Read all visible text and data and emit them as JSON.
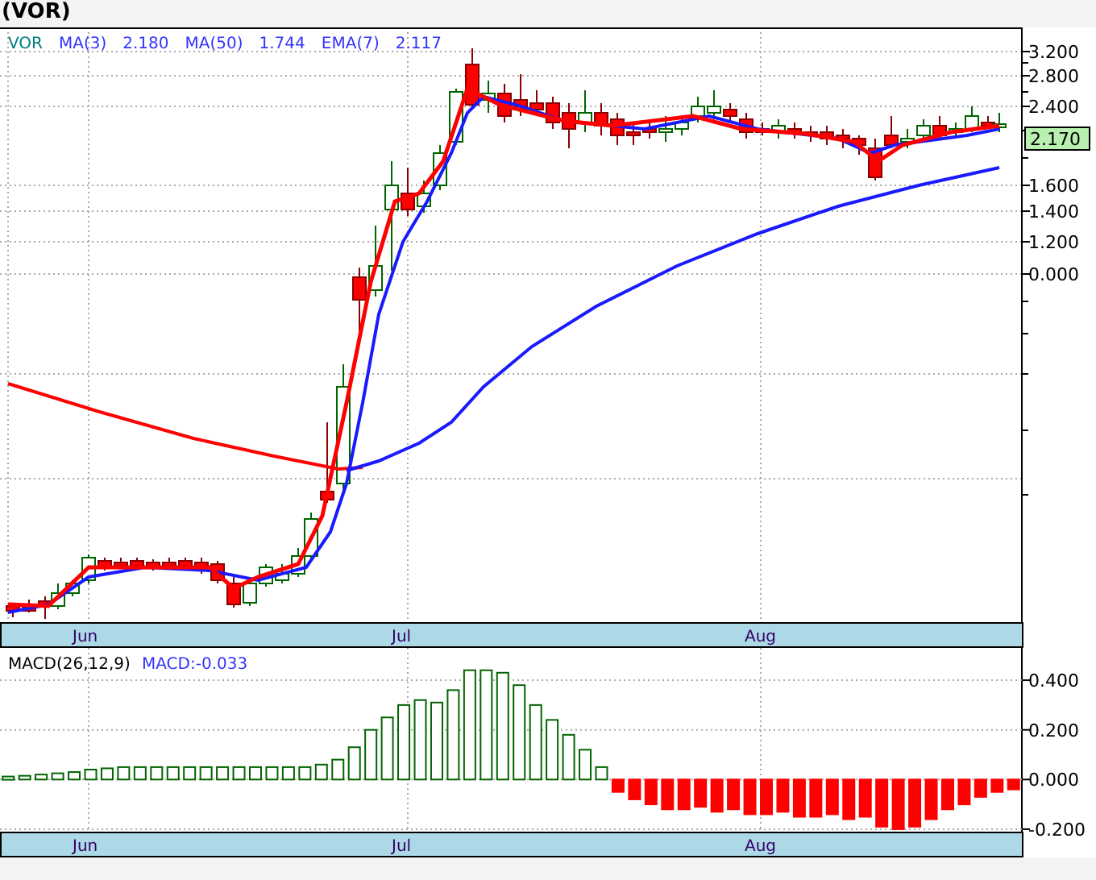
{
  "title": "(VOR)",
  "price_panel": {
    "kind": "picture",
    "legend": [
      {
        "text": "VOR",
        "color": "#008080"
      },
      {
        "text": "MA(3)",
        "color": "#3333ff"
      },
      {
        "text": "2.180",
        "color": "#3333ff"
      },
      {
        "text": "MA(50)",
        "color": "#3333ff"
      },
      {
        "text": "1.744",
        "color": "#3333ff"
      },
      {
        "text": "EMA(7)",
        "color": "#3333ff"
      },
      {
        "text": "2.117",
        "color": "#3333ff"
      }
    ],
    "axis_labels": [
      "3.200",
      "2.800",
      "2.400",
      "1.600",
      "1.400",
      "1.200",
      "0.000"
    ],
    "last_price": "2.170"
  },
  "top_axis": {
    "months": [
      "Jun",
      "Jul",
      "Aug"
    ]
  },
  "macd_panel": {
    "label": "MACD(26,12,9)",
    "reading": "MACD:-0.033",
    "chart_data": {
      "type": "bar",
      "stacked": true,
      "grid": true,
      "ylim": [
        -0.21,
        0.53
      ],
      "yticks": [
        {
          "value": 0.4,
          "label": "0.400"
        },
        {
          "value": 0.2,
          "label": "0.200"
        },
        {
          "value": 0,
          "label": "0.000"
        },
        {
          "value": -0.2,
          "label": "-0.200"
        }
      ],
      "series": [
        {
          "color": "#006400",
          "values": [
            0.012,
            0.015,
            0.02,
            0.025,
            0.03,
            0.04,
            0.045,
            0.05,
            0.05,
            0.05,
            0.05,
            0.05,
            0.05,
            0.05,
            0.05,
            0.05,
            0.05,
            0.05,
            0.05,
            0.06,
            0.08,
            0.13,
            0.2,
            0.25,
            0.3,
            0.32,
            0.31,
            0.36,
            0.44,
            0.44,
            0.43,
            0.38,
            0.3,
            0.24,
            0.18,
            0.12,
            0.05,
            null,
            null,
            null,
            null,
            null,
            null,
            null,
            null,
            null,
            null,
            null,
            null,
            null,
            null,
            null,
            null,
            null,
            null,
            null,
            null,
            null,
            null,
            null,
            null,
            null
          ]
        },
        {
          "color": "#ff0000",
          "values": [
            null,
            null,
            null,
            null,
            null,
            null,
            null,
            null,
            null,
            null,
            null,
            null,
            null,
            null,
            null,
            null,
            null,
            null,
            null,
            null,
            null,
            null,
            null,
            null,
            null,
            null,
            null,
            null,
            null,
            null,
            null,
            null,
            null,
            null,
            null,
            null,
            null,
            -0.05,
            -0.08,
            -0.1,
            -0.12,
            -0.12,
            -0.11,
            -0.13,
            -0.12,
            -0.14,
            -0.14,
            -0.13,
            -0.15,
            -0.15,
            -0.14,
            -0.16,
            -0.15,
            -0.19,
            -0.2,
            -0.19,
            -0.16,
            -0.12,
            -0.1,
            -0.07,
            -0.05,
            -0.04
          ]
        }
      ]
    }
  },
  "bottom_axis": {
    "months": [
      "Jun",
      "Jul",
      "Aug"
    ]
  }
}
